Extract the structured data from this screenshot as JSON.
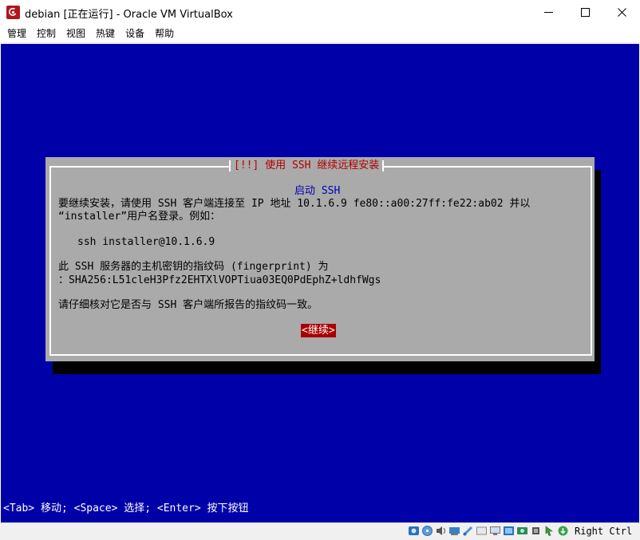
{
  "window": {
    "title": "debian [正在运行] - Oracle VM VirtualBox",
    "accent": "#b0161c"
  },
  "menu": {
    "items": [
      "管理",
      "控制",
      "视图",
      "热键",
      "设备",
      "帮助"
    ]
  },
  "dialog": {
    "title": "[!!] 使用 SSH 继续远程安装",
    "heading": "启动 SSH",
    "line1": "要继续安装，请使用 SSH 客户端连接至 IP 地址 10.1.6.9 fe80::a00:27ff:fe22:ab02 并以",
    "line2": "“installer”用户名登录。例如：",
    "example": "ssh installer@10.1.6.9",
    "fp_label": "此 SSH 服务器的主机密钥的指纹码 (fingerprint) 为",
    "fp_value": "：SHA256:L51cleH3Pfz2EHTXlVOPTiua03EQ0PdEphZ+ldhfWgs",
    "verify": "请仔细核对它是否与 SSH 客户端所报告的指纹码一致。",
    "continue_label": "<继续>"
  },
  "help_line": "<Tab> 移动; <Space> 选择; <Enter> 按下按钮",
  "status": {
    "host_key": "Right Ctrl",
    "icons": [
      "hard-disk-icon",
      "optical-drive-icon",
      "audio-icon",
      "network-icon",
      "usb-icon",
      "shared-folder-icon",
      "display-icon",
      "video-capture-icon",
      "recording-icon",
      "cpu-icon",
      "mouse-integration-icon",
      "keyboard-icon"
    ]
  },
  "colors": {
    "screen_bg": "#0000a8",
    "dialog_bg": "#aaaaaa",
    "title_red": "#b00000",
    "button_red": "#a80000"
  }
}
